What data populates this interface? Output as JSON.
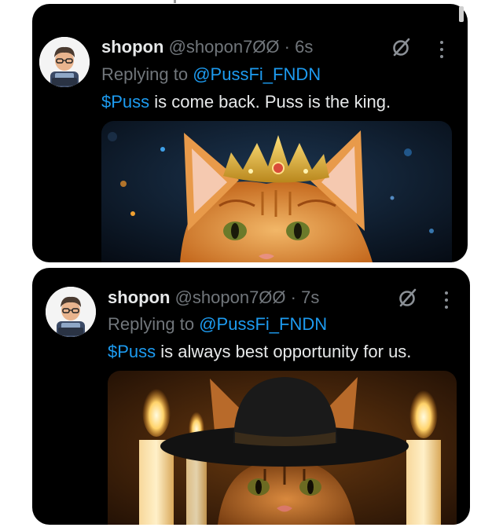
{
  "tweets": [
    {
      "author_name": "shopon",
      "handle": "@shopon7ØØ",
      "separator": "·",
      "time": "6s",
      "replying_prefix": "Replying to",
      "replying_to": "@PussFi_FNDN",
      "cashtag": "$Puss",
      "text": " is come back. Puss is the king.",
      "media_subject": "orange cat wearing a golden crown",
      "action_icon": "grok-slash-circle-icon",
      "menu_icon": "more-vertical-icon"
    },
    {
      "author_name": "shopon",
      "handle": "@shopon7ØØ",
      "separator": "·",
      "time": "7s",
      "replying_prefix": "Replying to",
      "replying_to": "@PussFi_FNDN",
      "cashtag": "$Puss",
      "text": " is always best opportunity for us.",
      "media_subject": "tabby cat wearing a black wide-brim hat among candles",
      "action_icon": "grok-slash-circle-icon",
      "menu_icon": "more-vertical-icon"
    }
  ],
  "colors": {
    "background": "#000000",
    "text_primary": "#e7e9ea",
    "text_secondary": "#71767b",
    "accent": "#1d9bf0"
  }
}
